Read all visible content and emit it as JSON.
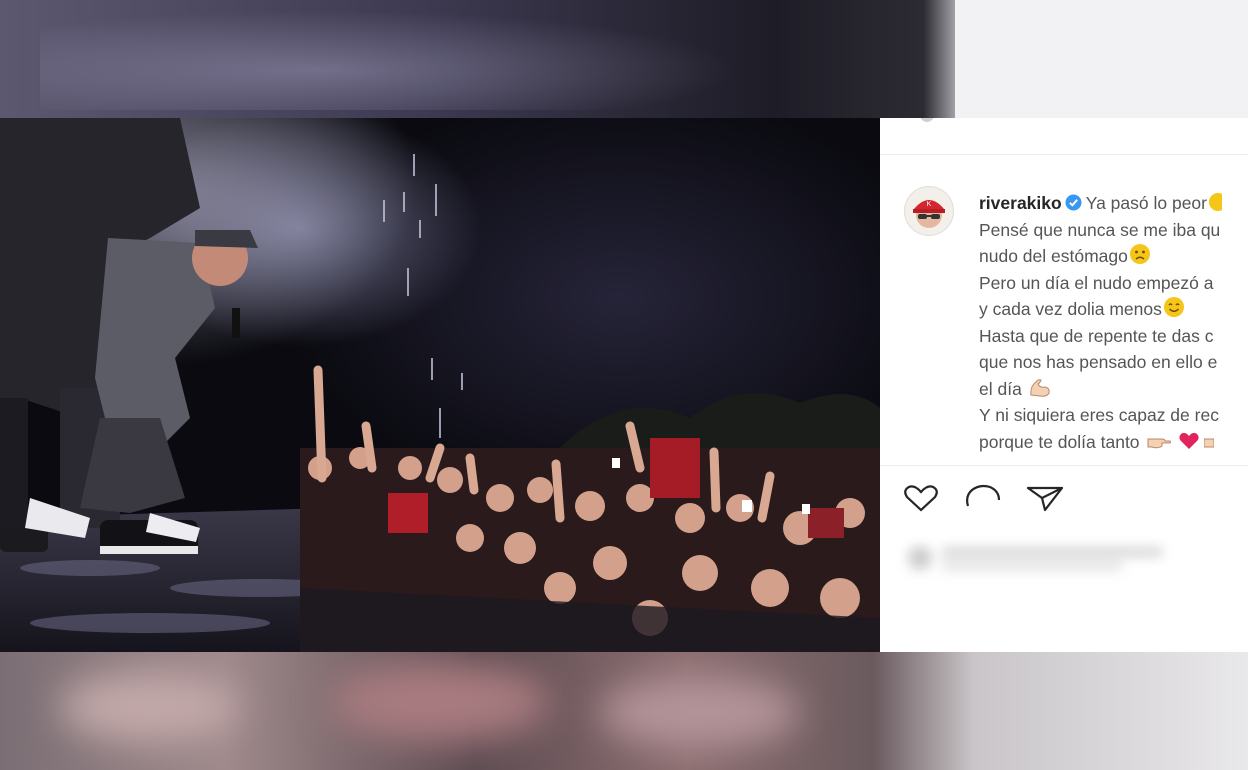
{
  "post": {
    "username": "riverakiko",
    "caption_lines": [
      "Ya pasó lo peor",
      "Pensé que nunca se me iba qu",
      "nudo del estómago",
      "Pero un día el nudo empezó a",
      "y cada vez dolia menos",
      "Hasta que de repente te das c",
      "que nos has pensado en ello e",
      "el día",
      "Y ni siquiera eres capaz de rec",
      "porque te dolía tanto"
    ],
    "icons": {
      "verified": "verified-badge-icon",
      "like": "heart-icon",
      "comment": "comment-icon",
      "share": "send-icon"
    },
    "colors": {
      "verified": "#3897f0",
      "emoji_yellow": "#f5c518",
      "heart_red": "#e0245e"
    }
  }
}
